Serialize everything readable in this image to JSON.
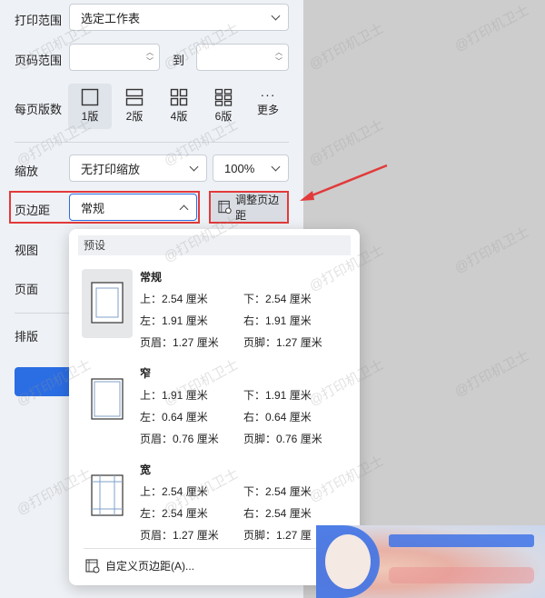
{
  "print_range": {
    "label": "打印范围",
    "value": "选定工作表"
  },
  "page_range": {
    "label": "页码范围",
    "to": "到",
    "from_value": "",
    "to_value": ""
  },
  "pages_per_sheet": {
    "label": "每页版数",
    "options": [
      "1版",
      "2版",
      "4版",
      "6版",
      "更多"
    ],
    "selected": "1版"
  },
  "scale": {
    "label": "缩放",
    "value": "无打印缩放",
    "percent": "100%"
  },
  "margins": {
    "label": "页边距",
    "value": "常规",
    "adjust_button": "调整页边距"
  },
  "view": {
    "label": "视图"
  },
  "page": {
    "label": "页面"
  },
  "layout": {
    "label": "排版"
  },
  "dropdown": {
    "header": "预设",
    "presets": [
      {
        "name": "常规",
        "top": "上：2.54 厘米",
        "bottom": "下：2.54 厘米",
        "left": "左：1.91 厘米",
        "right": "右：1.91 厘米",
        "header": "页眉：1.27 厘米",
        "footer": "页脚：1.27 厘米"
      },
      {
        "name": "窄",
        "top": "上：1.91 厘米",
        "bottom": "下：1.91 厘米",
        "left": "左：0.64 厘米",
        "right": "右：0.64 厘米",
        "header": "页眉：0.76 厘米",
        "footer": "页脚：0.76 厘米"
      },
      {
        "name": "宽",
        "top": "上：2.54 厘米",
        "bottom": "下：2.54 厘米",
        "left": "左：2.54 厘米",
        "right": "右：2.54 厘米",
        "header": "页眉：1.27 厘米",
        "footer": "页脚：1.27 厘"
      }
    ],
    "custom": "自定义页边距(A)..."
  },
  "watermark": "@打印机卫士",
  "colors": {
    "accent": "#2b6de3",
    "highlight": "#e23a3a"
  }
}
